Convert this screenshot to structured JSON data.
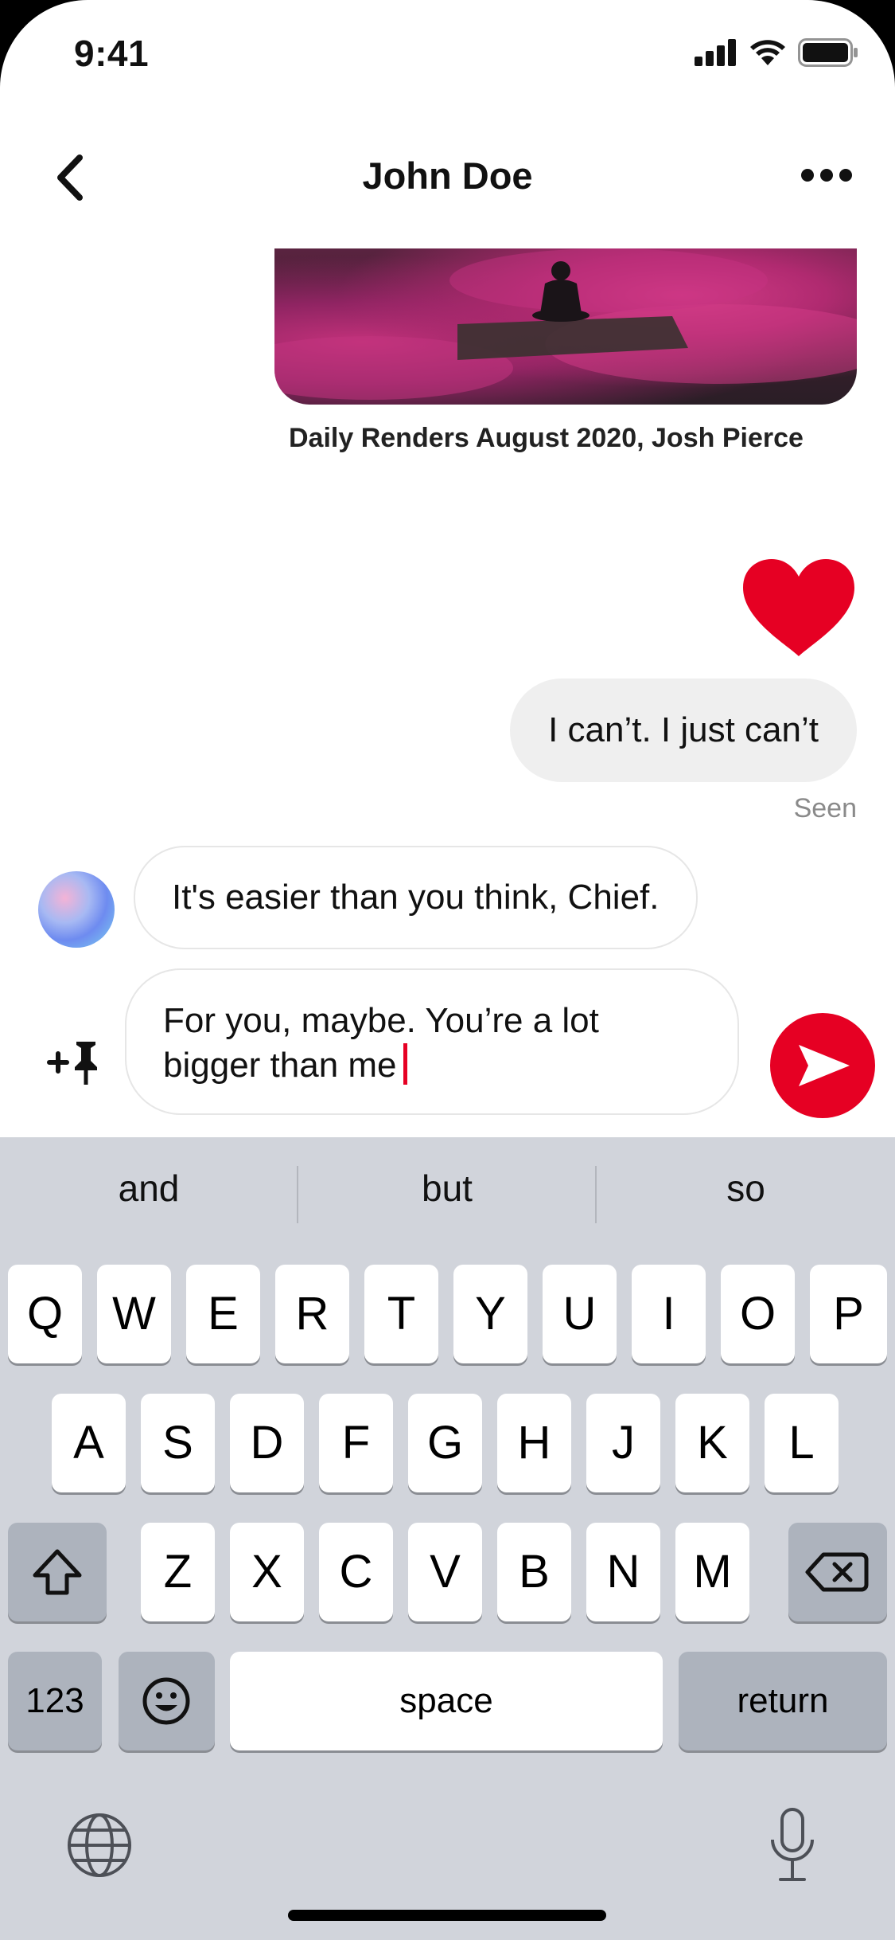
{
  "status_bar": {
    "time": "9:41"
  },
  "header": {
    "title": "John Doe"
  },
  "pin": {
    "caption": "Daily Renders August 2020, Josh Pierce"
  },
  "messages": {
    "outgoing": "I can’t. I just can’t",
    "seen_label": "Seen",
    "incoming": "It's easier than you think, Chief."
  },
  "composer": {
    "text": "For you, maybe. You’re a lot bigger than me"
  },
  "keyboard": {
    "suggestions": [
      "and",
      "but",
      "so"
    ],
    "row1": [
      "Q",
      "W",
      "E",
      "R",
      "T",
      "Y",
      "U",
      "I",
      "O",
      "P"
    ],
    "row2": [
      "A",
      "S",
      "D",
      "F",
      "G",
      "H",
      "J",
      "K",
      "L"
    ],
    "row3": [
      "Z",
      "X",
      "C",
      "V",
      "B",
      "N",
      "M"
    ],
    "numbers_label": "123",
    "space_label": "space",
    "return_label": "return"
  },
  "colors": {
    "accent": "#e60023",
    "keyboard_bg": "#d1d4db"
  }
}
